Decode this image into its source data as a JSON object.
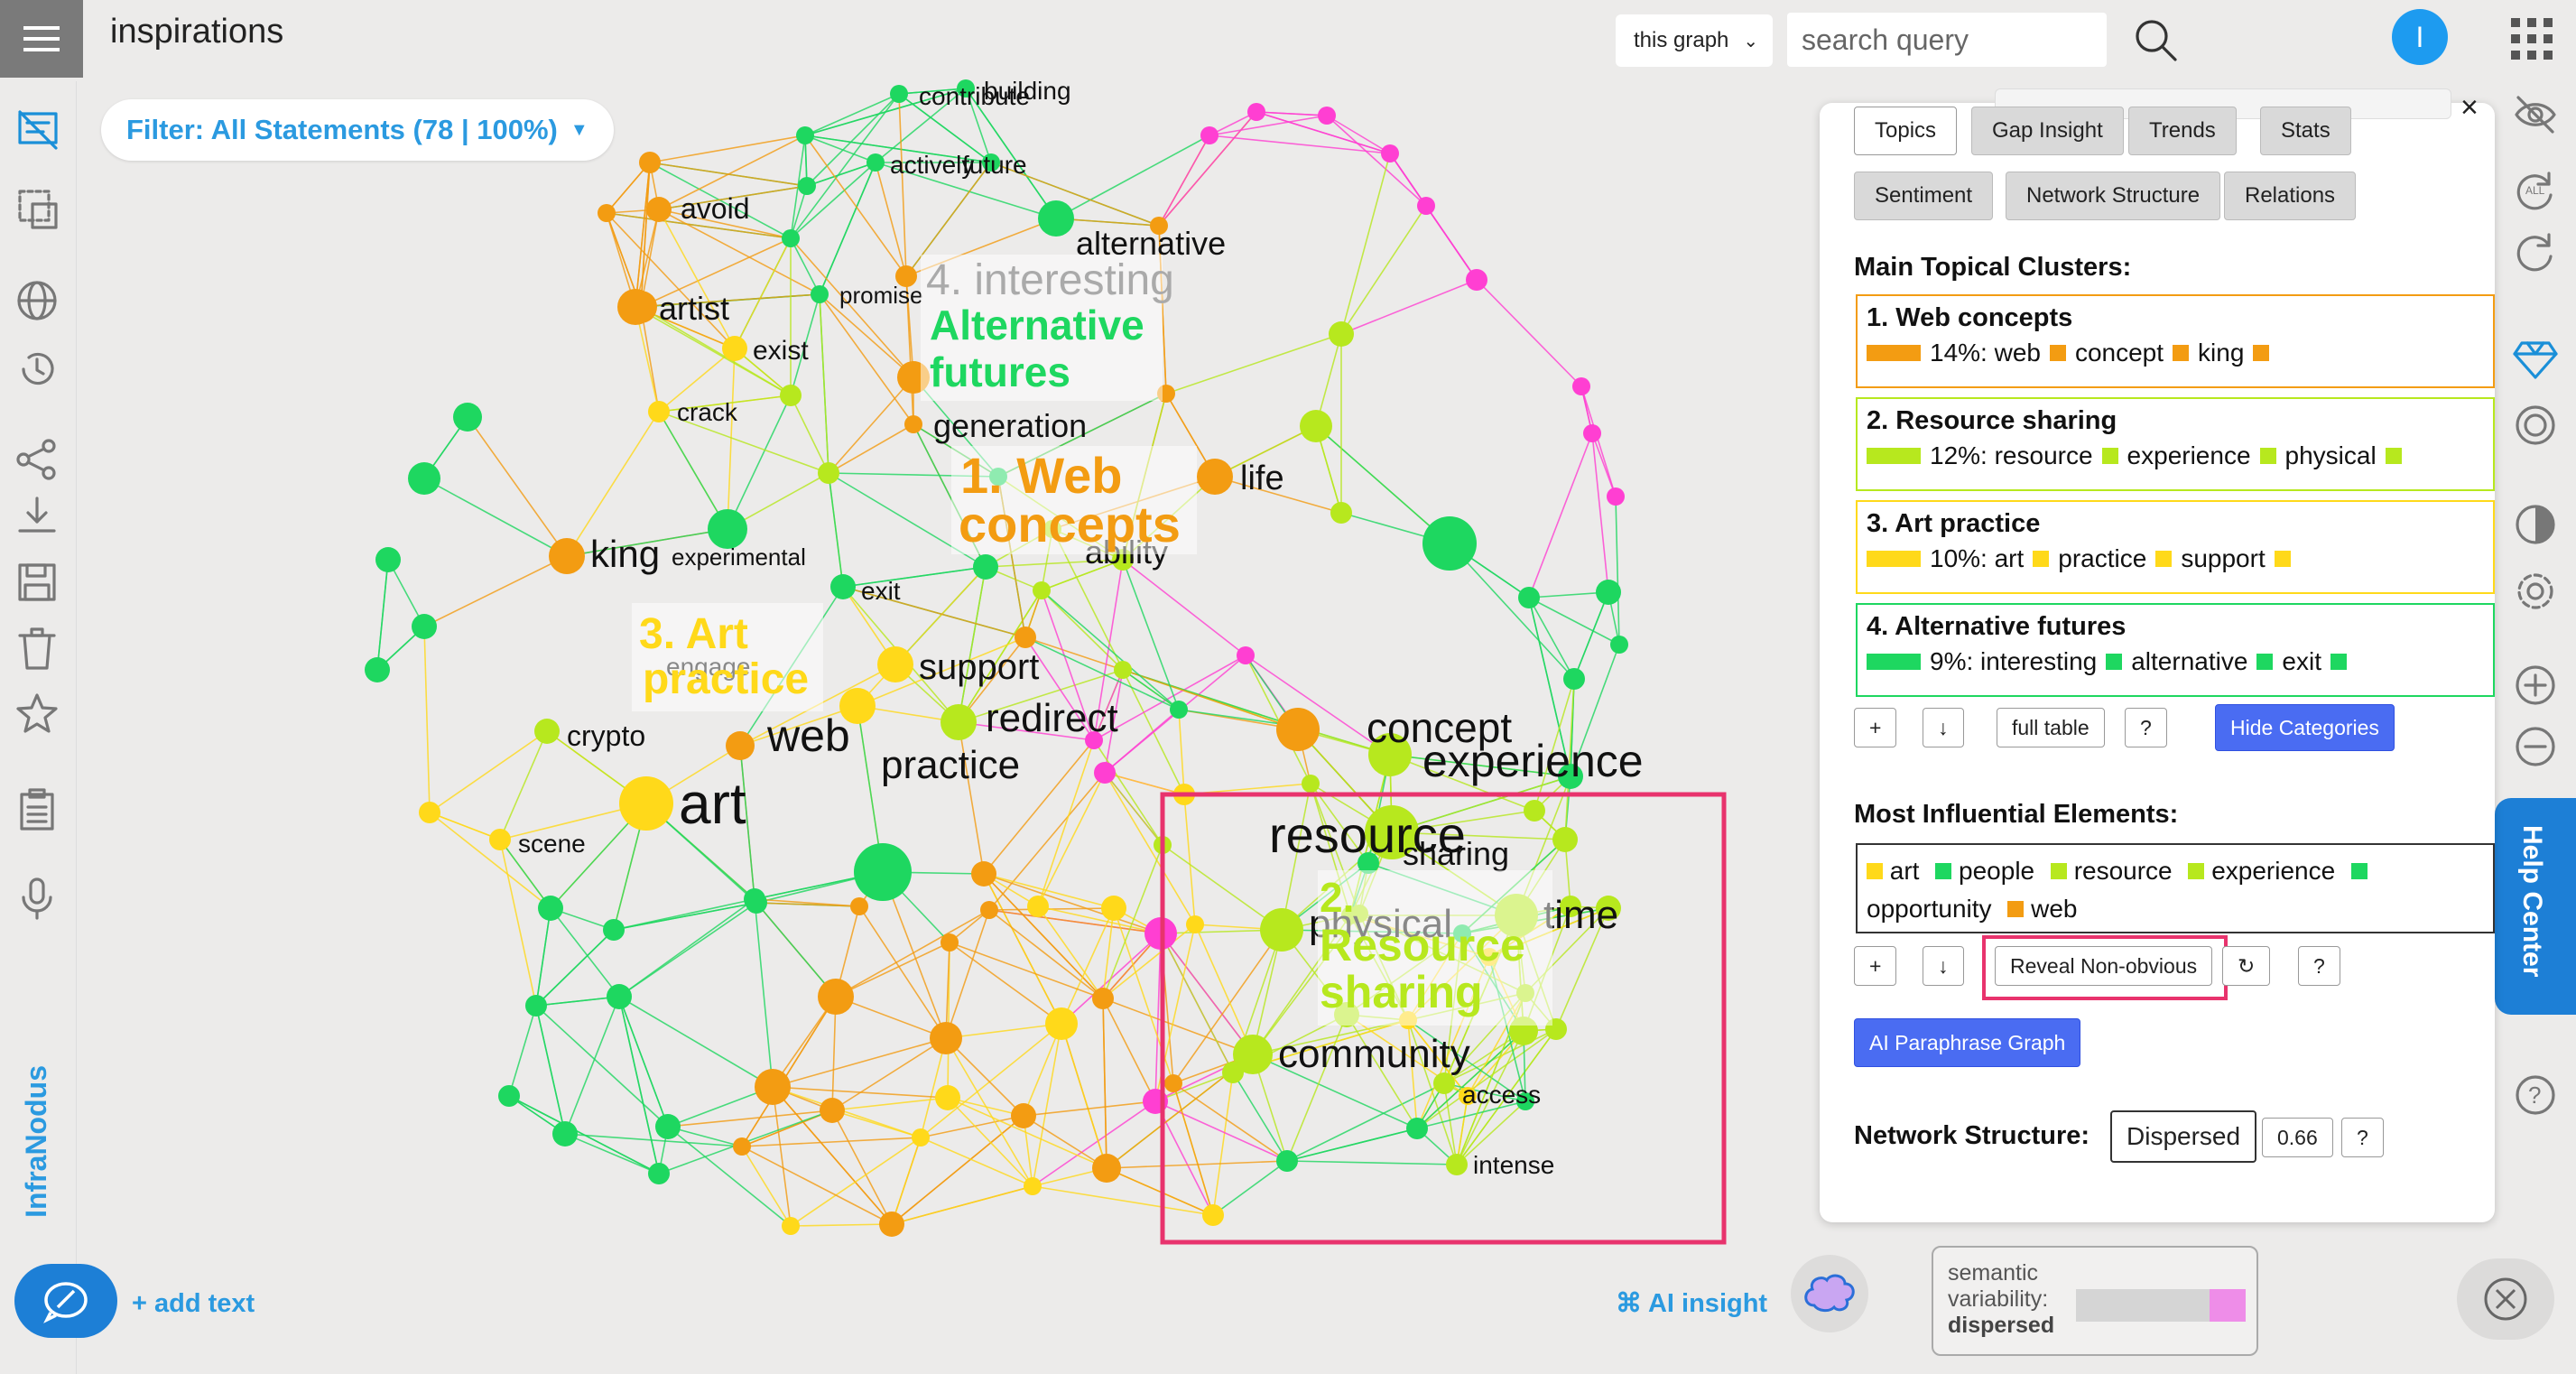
{
  "app": {
    "title": "inspirations",
    "brand": "InfraNodus",
    "avatar_letter": "I"
  },
  "filter": {
    "label": "Filter: All Statements (78 | 100%)"
  },
  "search": {
    "scope": "this graph",
    "placeholder": "search query"
  },
  "canvas": {
    "add_text": "+ add text",
    "ai_insight": "⌘ AI insight",
    "semantic": {
      "label_line1": "semantic",
      "label_line2": "variability:",
      "value": "dispersed"
    }
  },
  "colors": {
    "orange": "#f39c12",
    "yellowgreen": "#b7e81e",
    "yellow": "#ffd91a",
    "green": "#1ed760",
    "magenta": "#ff3fd2",
    "accent": "#2b9ae0",
    "highlight": "#e8336d"
  },
  "graph": {
    "cluster_labels": [
      {
        "text_line1": "4. interesting",
        "text_line2": "Alternative",
        "text_line3": "futures"
      },
      {
        "text_line1": "1. Web",
        "text_line2": "concepts"
      },
      {
        "text_line1": "3. Art",
        "text_line2": "practice"
      },
      {
        "text_line1": "2.",
        "text_line2": "Resource",
        "text_line3": "sharing"
      }
    ],
    "words": [
      "building",
      "contribute",
      "actively",
      "future",
      "avoid",
      "alternative",
      "promise",
      "artist",
      "exist",
      "crack",
      "generation",
      "life",
      "king",
      "experimental",
      "ability",
      "exit",
      "engage",
      "support",
      "crypto",
      "web",
      "redirect",
      "concept",
      "experience",
      "practice",
      "art",
      "scene",
      "resource",
      "sharing",
      "physical",
      "time",
      "community",
      "access",
      "intense"
    ]
  },
  "panel": {
    "tabs": [
      "Topics",
      "Gap Insight",
      "Trends",
      "Stats"
    ],
    "tabs2": [
      "Sentiment",
      "Network Structure",
      "Relations"
    ],
    "clusters_header": "Main Topical Clusters:",
    "clusters": [
      {
        "title": "1. Web concepts",
        "line": "14%: web",
        "w2": "concept",
        "w3": "king",
        "color": "#f39c12"
      },
      {
        "title": "2. Resource sharing",
        "line": "12%: resource",
        "w2": "experience",
        "w3": "physical",
        "color": "#b7e81e"
      },
      {
        "title": "3. Art practice",
        "line": "10%: art",
        "w2": "practice",
        "w3": "support",
        "color": "#ffd91a"
      },
      {
        "title": "4. Alternative futures",
        "line": "9%: interesting",
        "w2": "alternative",
        "w3": "exit",
        "color": "#1ed760"
      }
    ],
    "cluster_actions": {
      "plus": "+",
      "down": "↓",
      "full_table": "full table",
      "help": "?",
      "hide": "Hide Categories"
    },
    "influential_header": "Most Influential Elements:",
    "influential": [
      "art",
      "people",
      "resource",
      "experience",
      "opportunity",
      "web"
    ],
    "influential_actions": {
      "plus": "+",
      "down": "↓",
      "reveal": "Reveal Non-obvious",
      "refresh": "↻",
      "help": "?"
    },
    "paraphrase": "AI Paraphrase Graph",
    "structure_label": "Network Structure:",
    "structure_value": "Dispersed",
    "structure_score": "0.66",
    "structure_help": "?"
  },
  "help_center": "Help Center"
}
